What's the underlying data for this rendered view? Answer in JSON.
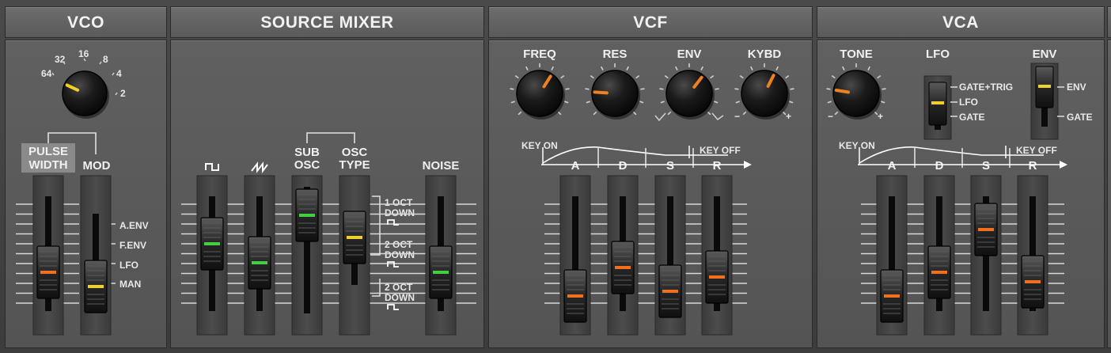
{
  "colors": {
    "panel": "#595959",
    "knob": "#151515",
    "pointer_orange": "#f08020",
    "pointer_yellow": "#f0d020",
    "led_green": "#40d040",
    "led_orange": "#f07020",
    "led_yellow": "#f0d030"
  },
  "sections": {
    "vco": "VCO",
    "mixer": "SOURCE MIXER",
    "vcf": "VCF",
    "vca": "VCA"
  },
  "vco": {
    "range_labels": [
      "64",
      "32",
      "16",
      "8",
      "4",
      "2"
    ],
    "pulse_width_1": "PULSE",
    "pulse_width_2": "WIDTH",
    "mod": "MOD",
    "mod_source_labels": [
      "A.ENV",
      "F.ENV",
      "LFO",
      "MAN"
    ],
    "pulse_width_level": 0.3,
    "mod_source": "MAN"
  },
  "mixer": {
    "pulse_icon": "pulse-wave-icon",
    "saw_icon": "sawtooth-wave-icon",
    "sub_osc_1": "SUB",
    "sub_osc_2": "OSC",
    "osc_type_1": "OSC",
    "osc_type_2": "TYPE",
    "noise": "NOISE",
    "osc_type_options": [
      {
        "l1": "1 OCT",
        "l2": "DOWN"
      },
      {
        "l1": "2 OCT",
        "l2": "DOWN"
      },
      {
        "l1": "2 OCT",
        "l2": "DOWN"
      }
    ],
    "pulse_level": 0.6,
    "saw_level": 0.4,
    "sub_osc_level": 0.9,
    "noise_level": 0.3,
    "osc_type": "1 OCT DOWN"
  },
  "vcf": {
    "freq": "FREQ",
    "res": "RES",
    "env": "ENV",
    "kybd": "KYBD",
    "key_on": "KEY ON",
    "key_off": "KEY OFF",
    "a": "A",
    "d": "D",
    "s": "S",
    "r": "R",
    "kybd_minus": "−",
    "kybd_plus": "+",
    "attack": 0.05,
    "decay": 0.35,
    "sustain": 0.1,
    "release": 0.25
  },
  "vca": {
    "tone": "TONE",
    "env_trig": "LFO",
    "vca_mode": "ENV",
    "tone_minus": "−",
    "tone_plus": "+",
    "env_trig_options": [
      "GATE+TRIG",
      "LFO",
      "GATE"
    ],
    "vca_mode_options": [
      "ENV",
      "GATE"
    ],
    "key_on": "KEY ON",
    "key_off": "KEY OFF",
    "a": "A",
    "d": "D",
    "s": "S",
    "r": "R",
    "attack": 0.05,
    "decay": 0.3,
    "sustain": 0.75,
    "release": 0.2
  }
}
